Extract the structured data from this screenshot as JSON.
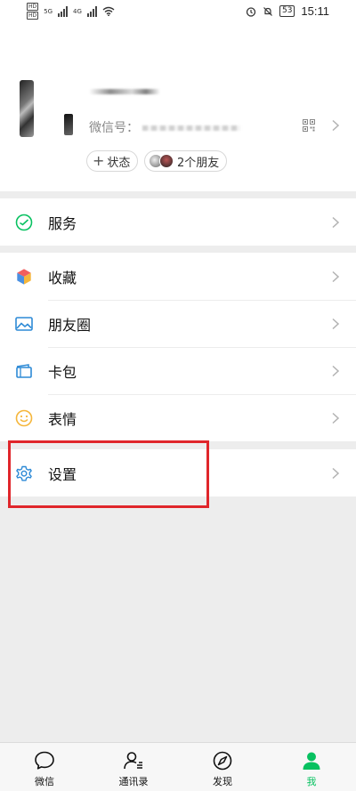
{
  "status_bar": {
    "hd_top": "HD",
    "hd_bottom": "HD",
    "network_1": "5G",
    "network_2": "4G",
    "battery": "53",
    "time": "15:11"
  },
  "profile": {
    "wechat_id_label": "微信号：",
    "status_button": "状态",
    "status_plus": "+",
    "friends_label": "2个朋友"
  },
  "menu": {
    "services": "服务",
    "favorites": "收藏",
    "moments": "朋友圈",
    "cards": "卡包",
    "stickers": "表情",
    "settings": "设置"
  },
  "tabbar": {
    "chats": "微信",
    "contacts": "通讯录",
    "discover": "发现",
    "me": "我"
  },
  "colors": {
    "accent": "#07c160",
    "highlight": "#e0262b",
    "background": "#ededed"
  }
}
